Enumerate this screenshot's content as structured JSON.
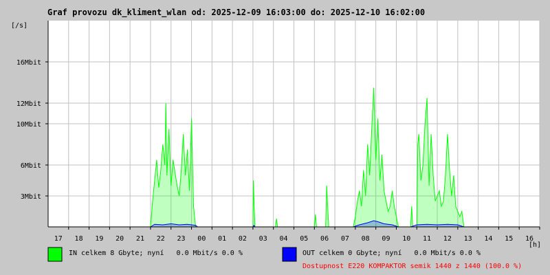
{
  "window": {
    "title": "Graf provozu dk_kliment_wlan od: 2025-12-09 16:03:00 do: 2025-12-10 16:02:00"
  },
  "colors": {
    "background": "#c8c8c8",
    "plot_background": "#ffffff",
    "grid": "#c0c0c0",
    "in_series": "#00ff00",
    "out_series": "#0000ff",
    "availability_text": "#ff0000"
  },
  "legend": {
    "in_label": "IN celkem 8 Gbyte; nyní   0.0 Mbit/s 0.0 %",
    "out_label": "OUT celkem 0 Gbyte; nyní   0.0 Mbit/s 0.0 %",
    "availability": "Dostupnost E220 KOMPAKTOR semik 1440 z 1440 (100.0 %)"
  },
  "chart_data": {
    "type": "area",
    "title": "Graf provozu dk_kliment_wlan od: 2025-12-09 16:03:00 do: 2025-12-10 16:02:00",
    "ylabel": "[/s]",
    "xlabel": "[h]",
    "ylim": [
      0,
      20
    ],
    "xlim": [
      16,
      40
    ],
    "grid": true,
    "y_ticks": [
      {
        "value": 3,
        "label": "3Mbit"
      },
      {
        "value": 6,
        "label": "6Mbit"
      },
      {
        "value": 10,
        "label": "10Mbit"
      },
      {
        "value": 12,
        "label": "12Mbit"
      },
      {
        "value": 16,
        "label": "16Mbit"
      }
    ],
    "x_ticks": [
      {
        "value": 17,
        "label": "17"
      },
      {
        "value": 18,
        "label": "18"
      },
      {
        "value": 19,
        "label": "19"
      },
      {
        "value": 20,
        "label": "20"
      },
      {
        "value": 21,
        "label": "21"
      },
      {
        "value": 22,
        "label": "22"
      },
      {
        "value": 23,
        "label": "23"
      },
      {
        "value": 24,
        "label": "00"
      },
      {
        "value": 25,
        "label": "01"
      },
      {
        "value": 26,
        "label": "02"
      },
      {
        "value": 27,
        "label": "03"
      },
      {
        "value": 28,
        "label": "04"
      },
      {
        "value": 29,
        "label": "05"
      },
      {
        "value": 30,
        "label": "06"
      },
      {
        "value": 31,
        "label": "07"
      },
      {
        "value": 32,
        "label": "08"
      },
      {
        "value": 33,
        "label": "09"
      },
      {
        "value": 34,
        "label": "10"
      },
      {
        "value": 35,
        "label": "11"
      },
      {
        "value": 36,
        "label": "12"
      },
      {
        "value": 37,
        "label": "13"
      },
      {
        "value": 38,
        "label": "14"
      },
      {
        "value": 39,
        "label": "15"
      },
      {
        "value": 40,
        "label": "16"
      }
    ],
    "series": [
      {
        "name": "IN",
        "color": "#00ff00",
        "points": [
          [
            21.0,
            0
          ],
          [
            21.1,
            2.5
          ],
          [
            21.2,
            4.5
          ],
          [
            21.3,
            6.5
          ],
          [
            21.4,
            3.8
          ],
          [
            21.5,
            5.5
          ],
          [
            21.6,
            8.0
          ],
          [
            21.7,
            6.0
          ],
          [
            21.75,
            12.0
          ],
          [
            21.8,
            5.0
          ],
          [
            21.9,
            9.5
          ],
          [
            22.0,
            4.0
          ],
          [
            22.1,
            6.5
          ],
          [
            22.2,
            5.2
          ],
          [
            22.3,
            4.0
          ],
          [
            22.4,
            3.0
          ],
          [
            22.5,
            5.5
          ],
          [
            22.6,
            9.0
          ],
          [
            22.7,
            5.0
          ],
          [
            22.8,
            7.5
          ],
          [
            22.9,
            3.5
          ],
          [
            23.0,
            10.5
          ],
          [
            23.1,
            2.0
          ],
          [
            23.2,
            0
          ],
          [
            26.0,
            0
          ],
          [
            26.02,
            4.5
          ],
          [
            26.06,
            2.0
          ],
          [
            26.1,
            0
          ],
          [
            27.1,
            0
          ],
          [
            27.15,
            0.8
          ],
          [
            27.2,
            0
          ],
          [
            29.0,
            0
          ],
          [
            29.05,
            1.2
          ],
          [
            29.1,
            0
          ],
          [
            29.55,
            0
          ],
          [
            29.6,
            4.0
          ],
          [
            29.65,
            2.0
          ],
          [
            29.7,
            0
          ],
          [
            30.9,
            0
          ],
          [
            31.0,
            1.0
          ],
          [
            31.1,
            2.5
          ],
          [
            31.2,
            3.5
          ],
          [
            31.3,
            2.0
          ],
          [
            31.4,
            5.5
          ],
          [
            31.5,
            3.0
          ],
          [
            31.6,
            8.0
          ],
          [
            31.7,
            5.0
          ],
          [
            31.8,
            9.5
          ],
          [
            31.9,
            13.5
          ],
          [
            32.0,
            6.5
          ],
          [
            32.1,
            10.5
          ],
          [
            32.2,
            4.5
          ],
          [
            32.3,
            7.0
          ],
          [
            32.4,
            3.5
          ],
          [
            32.5,
            2.5
          ],
          [
            32.6,
            1.5
          ],
          [
            32.7,
            2.0
          ],
          [
            32.8,
            3.5
          ],
          [
            32.9,
            2.0
          ],
          [
            33.0,
            1.0
          ],
          [
            33.1,
            0
          ],
          [
            33.7,
            0
          ],
          [
            33.75,
            2.0
          ],
          [
            33.8,
            0
          ],
          [
            34.0,
            0
          ],
          [
            34.05,
            8.0
          ],
          [
            34.1,
            9.0
          ],
          [
            34.2,
            4.5
          ],
          [
            34.3,
            6.0
          ],
          [
            34.4,
            10.0
          ],
          [
            34.5,
            12.5
          ],
          [
            34.6,
            4.0
          ],
          [
            34.7,
            9.0
          ],
          [
            34.8,
            5.0
          ],
          [
            34.9,
            2.5
          ],
          [
            35.0,
            3.0
          ],
          [
            35.1,
            3.5
          ],
          [
            35.2,
            2.0
          ],
          [
            35.3,
            2.5
          ],
          [
            35.4,
            5.0
          ],
          [
            35.5,
            9.0
          ],
          [
            35.6,
            5.5
          ],
          [
            35.7,
            3.0
          ],
          [
            35.8,
            5.0
          ],
          [
            35.9,
            2.0
          ],
          [
            36.0,
            1.5
          ],
          [
            36.1,
            1.0
          ],
          [
            36.2,
            1.5
          ],
          [
            36.3,
            0
          ]
        ]
      },
      {
        "name": "OUT",
        "color": "#0000ff",
        "points": [
          [
            21.0,
            0
          ],
          [
            21.2,
            0.25
          ],
          [
            21.6,
            0.2
          ],
          [
            22.0,
            0.3
          ],
          [
            22.4,
            0.2
          ],
          [
            22.8,
            0.25
          ],
          [
            23.2,
            0.15
          ],
          [
            23.3,
            0
          ],
          [
            26.0,
            0
          ],
          [
            26.05,
            0.15
          ],
          [
            26.1,
            0
          ],
          [
            30.9,
            0
          ],
          [
            31.2,
            0.2
          ],
          [
            31.6,
            0.4
          ],
          [
            31.9,
            0.6
          ],
          [
            32.1,
            0.5
          ],
          [
            32.4,
            0.3
          ],
          [
            32.8,
            0.2
          ],
          [
            33.1,
            0
          ],
          [
            33.7,
            0
          ],
          [
            34.0,
            0.2
          ],
          [
            34.5,
            0.25
          ],
          [
            35.0,
            0.2
          ],
          [
            35.5,
            0.25
          ],
          [
            36.0,
            0.2
          ],
          [
            36.3,
            0
          ]
        ]
      }
    ]
  }
}
